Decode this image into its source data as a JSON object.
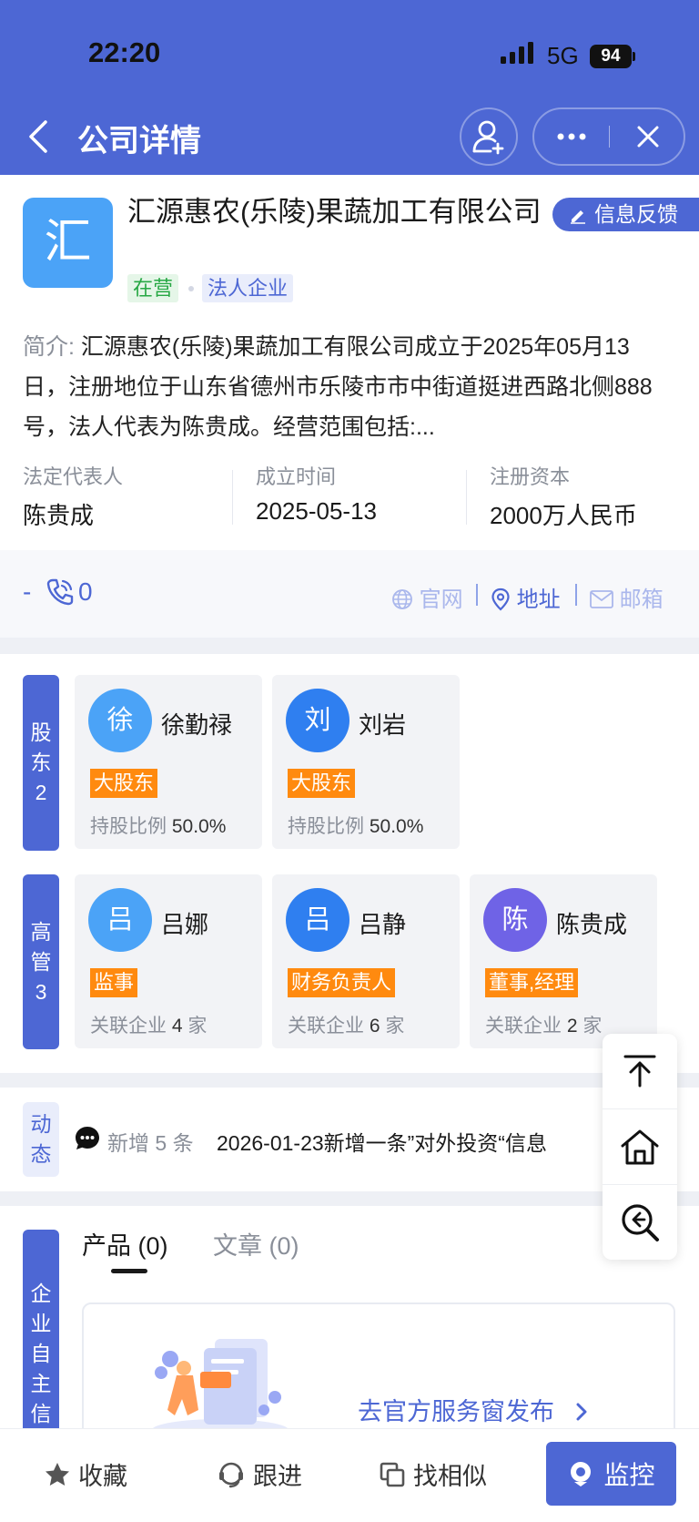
{
  "status_bar": {
    "time": "22:20",
    "network": "5G",
    "battery": "94"
  },
  "header": {
    "title": "公司详情"
  },
  "company": {
    "logo_char": "汇",
    "name": "汇源惠农(乐陵)果蔬加工有限公司",
    "feedback_label": "信息反馈",
    "status_tag": "在营",
    "type_tag": "法人企业",
    "intro_label": "简介:",
    "intro_text": "汇源惠农(乐陵)果蔬加工有限公司成立于2025年05月13日，注册地位于山东省德州市乐陵市市中街道挺进西路北侧888号，法人代表为陈贵成。经营范围包括:...",
    "info": [
      {
        "label": "法定代表人",
        "value": "陈贵成"
      },
      {
        "label": "成立时间",
        "value": "2025-05-13"
      },
      {
        "label": "注册资本",
        "value": "2000万人民币"
      }
    ]
  },
  "contact": {
    "dash": "-",
    "phone_count": "0",
    "links": [
      {
        "label": "官网",
        "icon": "globe-icon",
        "enabled": false
      },
      {
        "label": "地址",
        "icon": "location-pin-icon",
        "enabled": true
      },
      {
        "label": "邮箱",
        "icon": "mail-icon",
        "enabled": false
      }
    ]
  },
  "shareholders": {
    "label": [
      "股",
      "东",
      "2"
    ],
    "items": [
      {
        "avatar": "徐",
        "name": "徐勤禄",
        "role": "大股东",
        "meta_label": "持股比例",
        "meta_value": "50.0%",
        "color": "#4ba3f7"
      },
      {
        "avatar": "刘",
        "name": "刘岩",
        "role": "大股东",
        "meta_label": "持股比例",
        "meta_value": "50.0%",
        "color": "#2f7ff0"
      }
    ]
  },
  "executives": {
    "label": [
      "高",
      "管",
      "3"
    ],
    "items": [
      {
        "avatar": "吕",
        "name": "吕娜",
        "role": "监事",
        "meta_label": "关联企业",
        "meta_value": "4",
        "meta_unit": "家",
        "color": "#4ba3f7"
      },
      {
        "avatar": "吕",
        "name": "吕静",
        "role": "财务负责人",
        "meta_label": "关联企业",
        "meta_value": "6",
        "meta_unit": "家",
        "color": "#2f7ff0"
      },
      {
        "avatar": "陈",
        "name": "陈贵成",
        "role": "董事,经理",
        "meta_label": "关联企业",
        "meta_value": "2",
        "meta_unit": "家",
        "color": "#6f63e6"
      }
    ]
  },
  "dynamics": {
    "label": [
      "动",
      "态"
    ],
    "new_count_text": "新增 5 条",
    "latest": "2026-01-23新增一条”对外投资“信息"
  },
  "products": {
    "side_label": [
      "企",
      "业",
      "自",
      "主",
      "信"
    ],
    "tabs": [
      {
        "label": "产品 (0)"
      },
      {
        "label": "文章 (0)"
      }
    ],
    "publish_link": "去官方服务窗发布"
  },
  "bottom_bar": {
    "favorite": "收藏",
    "follow": "跟进",
    "similar": "找相似",
    "monitor": "监控"
  }
}
